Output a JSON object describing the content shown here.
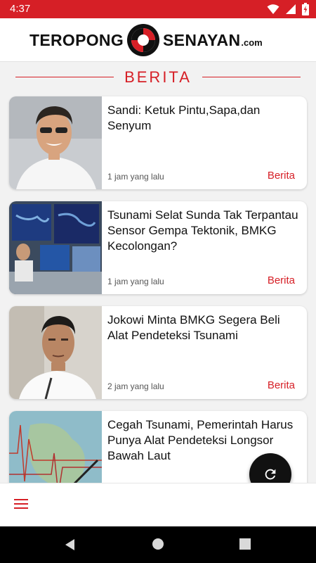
{
  "status_bar": {
    "time": "4:37"
  },
  "header": {
    "logo_left": "TEROPONG",
    "logo_right": "SENAYAN",
    "logo_domain": ".com"
  },
  "section": {
    "title": "BERITA"
  },
  "news": [
    {
      "headline": "Sandi: Ketuk Pintu,Sapa,dan Senyum",
      "time": "1 jam yang lalu",
      "category": "Berita"
    },
    {
      "headline": "Tsunami Selat Sunda Tak Terpantau Sensor Gempa Tektonik, BMKG Kecolongan?",
      "time": "1 jam yang lalu",
      "category": "Berita"
    },
    {
      "headline": "Jokowi Minta BMKG Segera Beli Alat Pendeteksi Tsunami",
      "time": "2 jam yang lalu",
      "category": "Berita"
    },
    {
      "headline": "Cegah Tsunami, Pemerintah Harus Punya Alat Pendeteksi Longsor Bawah Laut",
      "time": "",
      "category": ""
    }
  ],
  "colors": {
    "accent": "#d61f26",
    "fab": "#111111"
  },
  "icons": {
    "wifi": "wifi-icon",
    "signal": "signal-icon",
    "battery": "battery-icon",
    "refresh": "refresh-icon",
    "menu": "hamburger-menu-icon",
    "back": "back-icon",
    "home": "home-icon",
    "recents": "recents-icon"
  }
}
